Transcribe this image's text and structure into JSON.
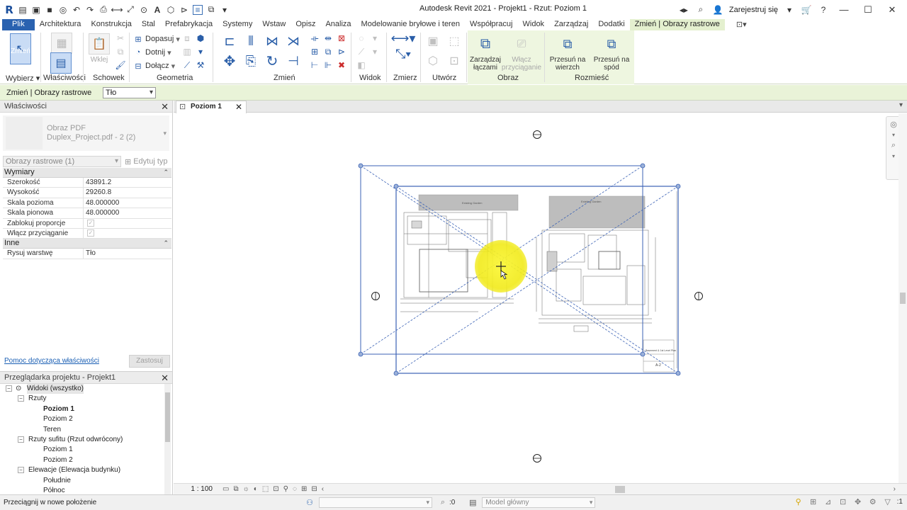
{
  "app": {
    "title": "Autodesk Revit 2021 - Projekt1 - Rzut: Poziom 1",
    "sign_in": "Zarejestruj się",
    "logo": "R"
  },
  "ribbon_tabs": [
    "Plik",
    "Architektura",
    "Konstrukcja",
    "Stal",
    "Prefabrykacja",
    "Systemy",
    "Wstaw",
    "Opisz",
    "Analiza",
    "Modelowanie bryłowe i teren",
    "Współpracuj",
    "Widok",
    "Zarządzaj",
    "Dodatki",
    "Zmień | Obrazy rastrowe"
  ],
  "ribbon": {
    "modify_label": "Zmień",
    "paste_label": "Wklej",
    "fit_label": "Dopasuj",
    "cut_label": "Dotnij",
    "join_label": "Dołącz",
    "manage_links_label": "Zarządzaj łączami",
    "snap_label": "Włącz przyciąganie",
    "bring_front_label": "Przesuń na wierzch",
    "send_back_label": "Przesuń na spód",
    "panels": {
      "select": "Wybierz",
      "properties": "Właściwości",
      "clipboard": "Schowek",
      "geometry": "Geometria",
      "modify": "Zmień",
      "view": "Widok",
      "measure": "Zmierz",
      "create": "Utwórz",
      "image": "Obraz",
      "arrange": "Rozmieść"
    }
  },
  "options_bar": {
    "context": "Zmień | Obrazy rastrowe",
    "layer_value": "Tło"
  },
  "properties": {
    "title": "Właściwości",
    "type_line1": "Obraz PDF",
    "type_line2": "Duplex_Project.pdf - 2 (2)",
    "filter": "Obrazy rastrowe (1)",
    "edit_type": "Edytuj typ",
    "groups": [
      {
        "name": "Wymiary",
        "rows": [
          {
            "key": "Szerokość",
            "value": "43891.2"
          },
          {
            "key": "Wysokość",
            "value": "29260.8"
          },
          {
            "key": "Skala pozioma",
            "value": "48.000000"
          },
          {
            "key": "Skala pionowa",
            "value": "48.000000"
          },
          {
            "key": "Zablokuj proporcje",
            "value": ""
          },
          {
            "key": "Włącz przyciąganie",
            "value": ""
          }
        ]
      },
      {
        "name": "Inne",
        "rows": [
          {
            "key": "Rysuj warstwę",
            "value": "Tło"
          }
        ]
      }
    ],
    "help_link": "Pomoc dotycząca właściwości",
    "apply": "Zastosuj"
  },
  "browser": {
    "title": "Przeglądarka projektu - Projekt1",
    "nodes": [
      {
        "label": "Widoki (wszystko)",
        "level": 0,
        "toggle": "−",
        "selected": true
      },
      {
        "label": "Rzuty",
        "level": 1,
        "toggle": "−"
      },
      {
        "label": "Poziom 1",
        "level": 2,
        "bold": true
      },
      {
        "label": "Poziom 2",
        "level": 2
      },
      {
        "label": "Teren",
        "level": 2
      },
      {
        "label": "Rzuty sufitu (Rzut odwrócony)",
        "level": 1,
        "toggle": "−"
      },
      {
        "label": "Poziom 1",
        "level": 2
      },
      {
        "label": "Poziom 2",
        "level": 2
      },
      {
        "label": "Elewacje (Elewacja budynku)",
        "level": 1,
        "toggle": "−"
      },
      {
        "label": "Południe",
        "level": 2
      },
      {
        "label": "Północ",
        "level": 2
      }
    ]
  },
  "view": {
    "tab": "Poziom 1",
    "scale": "1 : 100",
    "sheet_labels": [
      "Existing Garden",
      "Existing Garden",
      "Basement & 1st Level Plan",
      "A-2"
    ]
  },
  "status": {
    "message": "Przeciągnij w nowe położenie",
    "zero": ":0",
    "model": "Model główny",
    "filter_count": ":1"
  },
  "colors": {
    "file_tab": "#2a62b0",
    "context_tab": "#e4f0cf",
    "selection_blue": "#3b62b5",
    "cursor_highlight": "#f3ee1e"
  }
}
